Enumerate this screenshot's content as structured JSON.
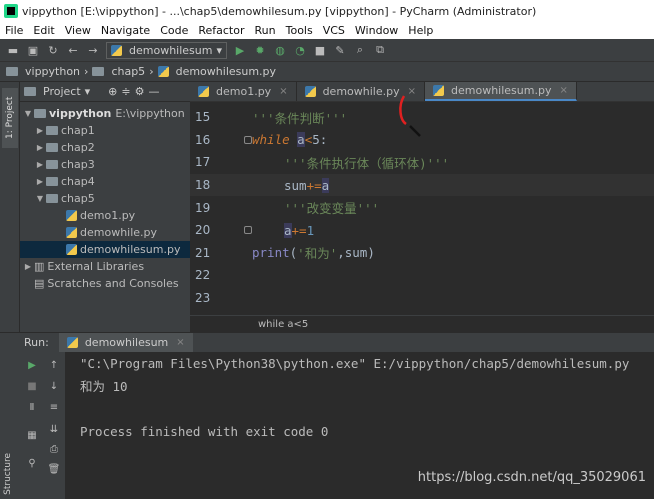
{
  "window": {
    "title": "vippython [E:\\vippython] - ...\\chap5\\demowhilesum.py [vippython] - PyCharm (Administrator)"
  },
  "menu": [
    "File",
    "Edit",
    "View",
    "Navigate",
    "Code",
    "Refactor",
    "Run",
    "Tools",
    "VCS",
    "Window",
    "Help"
  ],
  "toolbar": {
    "run_config": "demowhilesum"
  },
  "navbar": {
    "project": "vippython",
    "folder": "chap5",
    "file": "demowhilesum.py"
  },
  "sidebar": {
    "project_tab": "1: Project",
    "structure_tab": "Structure"
  },
  "project": {
    "header": "Project",
    "root": "vippython",
    "root_path": "E:\\vippython",
    "folders": [
      "chap1",
      "chap2",
      "chap3",
      "chap4",
      "chap5"
    ],
    "files": [
      "demo1.py",
      "demowhile.py",
      "demowhilesum.py"
    ],
    "external": "External Libraries",
    "scratches": "Scratches and Consoles"
  },
  "tabs": [
    "demo1.py",
    "demowhile.py",
    "demowhilesum.py"
  ],
  "code": {
    "line_numbers": [
      "15",
      "16",
      "17",
      "18",
      "19",
      "20",
      "21",
      "22",
      "23"
    ],
    "l15": "'''条件判断'''",
    "l16_kw": "while",
    "l16_a": "a",
    "l16_op": "<",
    "l16_rest": "5:",
    "l17": "'''条件执行体（循环体)'''",
    "l18_var": "sum",
    "l18_op": "+=",
    "l18_a": "a",
    "l19": "'''改变变量'''",
    "l20_a": "a",
    "l20_op": "+=",
    "l20_num": "1",
    "l21_fn": "print",
    "l21_open": "(",
    "l21_str": "'和为'",
    "l21_rest": ",sum)"
  },
  "breadcrumb": "while a<5",
  "run": {
    "label": "Run:",
    "tab": "demowhilesum",
    "lines": [
      "\"C:\\Program Files\\Python38\\python.exe\" E:/vippython/chap5/demowhilesum.py",
      "和为 10",
      "",
      "Process finished with exit code 0"
    ]
  },
  "watermark": "https://blog.csdn.net/qq_35029061",
  "colors": {
    "keyword": "#cc7832",
    "string": "#6a8759",
    "selection": "#0d293e"
  }
}
